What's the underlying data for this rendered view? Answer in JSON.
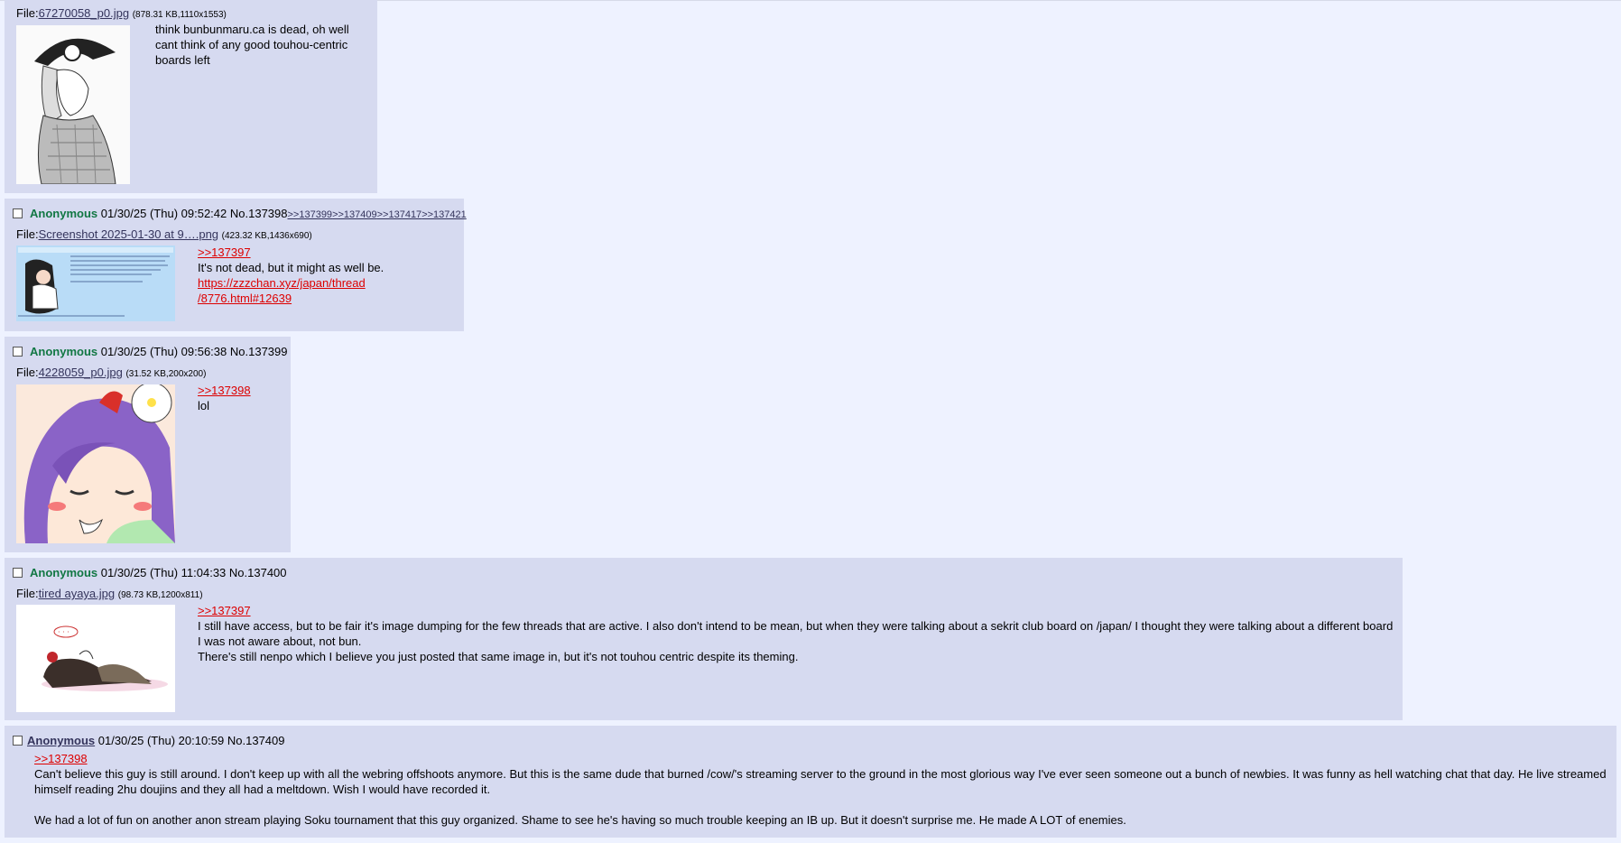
{
  "op": {
    "file_label": "File:",
    "file_name": "67270058_p0.jpg",
    "file_meta": "(878.31 KB,1110x1553)",
    "text": "think bunbunmaru.ca is dead, oh well cant think of any good touhou-centric boards left"
  },
  "posts": [
    {
      "name": "Anonymous",
      "datetime": "01/30/25 (Thu) 09:52:42",
      "number": "No.137398",
      "backlinks": [
        ">>137399",
        ">>137409",
        ">>137417",
        ">>137421"
      ],
      "file_label": "File:",
      "file_name": "Screenshot 2025-01-30 at 9….png",
      "file_meta": "(423.32 KB,1436x690)",
      "quote": ">>137397",
      "lines": [
        "It's not dead, but it might as well be."
      ],
      "link": [
        "https://zzzchan.xyz/japan/thread",
        "/8776.html#12639"
      ]
    },
    {
      "name": "Anonymous",
      "datetime": "01/30/25 (Thu) 09:56:38",
      "number": "No.137399",
      "file_label": "File:",
      "file_name": "4228059_p0.jpg",
      "file_meta": "(31.52 KB,200x200)",
      "quote": ">>137398",
      "lines": [
        "lol"
      ]
    },
    {
      "name": "Anonymous",
      "datetime": "01/30/25 (Thu) 11:04:33",
      "number": "No.137400",
      "file_label": "File:",
      "file_name": "tired ayaya.jpg",
      "file_meta": "(98.73 KB,1200x811)",
      "quote": ">>137397",
      "lines": [
        "I still have access, but to be fair it's image dumping for the few threads that are active. I also don't intend to be mean, but when they were talking about a sekrit club board on /japan/ I thought they were talking about a different board",
        "I was not aware about, not bun.",
        "There's still nenpo which I believe you just posted that same image in, but it's not touhou centric despite its theming."
      ]
    },
    {
      "name": "Anonymous",
      "datetime": "01/30/25 (Thu) 20:10:59",
      "number": "No.137409",
      "quote": ">>137398",
      "paragraphs": [
        "Can't believe this guy is still around. I don't keep up with all the webring offshoots anymore. But this is the same dude that burned /cow/'s streaming server to the ground in the most glorious way I've ever seen someone out a bunch of newbies. It was funny as hell watching chat that day. He live streamed himself reading 2hu doujins and they all had a meltdown. Wish I would have recorded it.",
        "We had a lot of fun on another anon stream playing Soku tournament that this guy organized. Shame to see he's having so much trouble keeping an IB up. But it doesn't surprise me. He made A LOT of enemies."
      ]
    }
  ]
}
